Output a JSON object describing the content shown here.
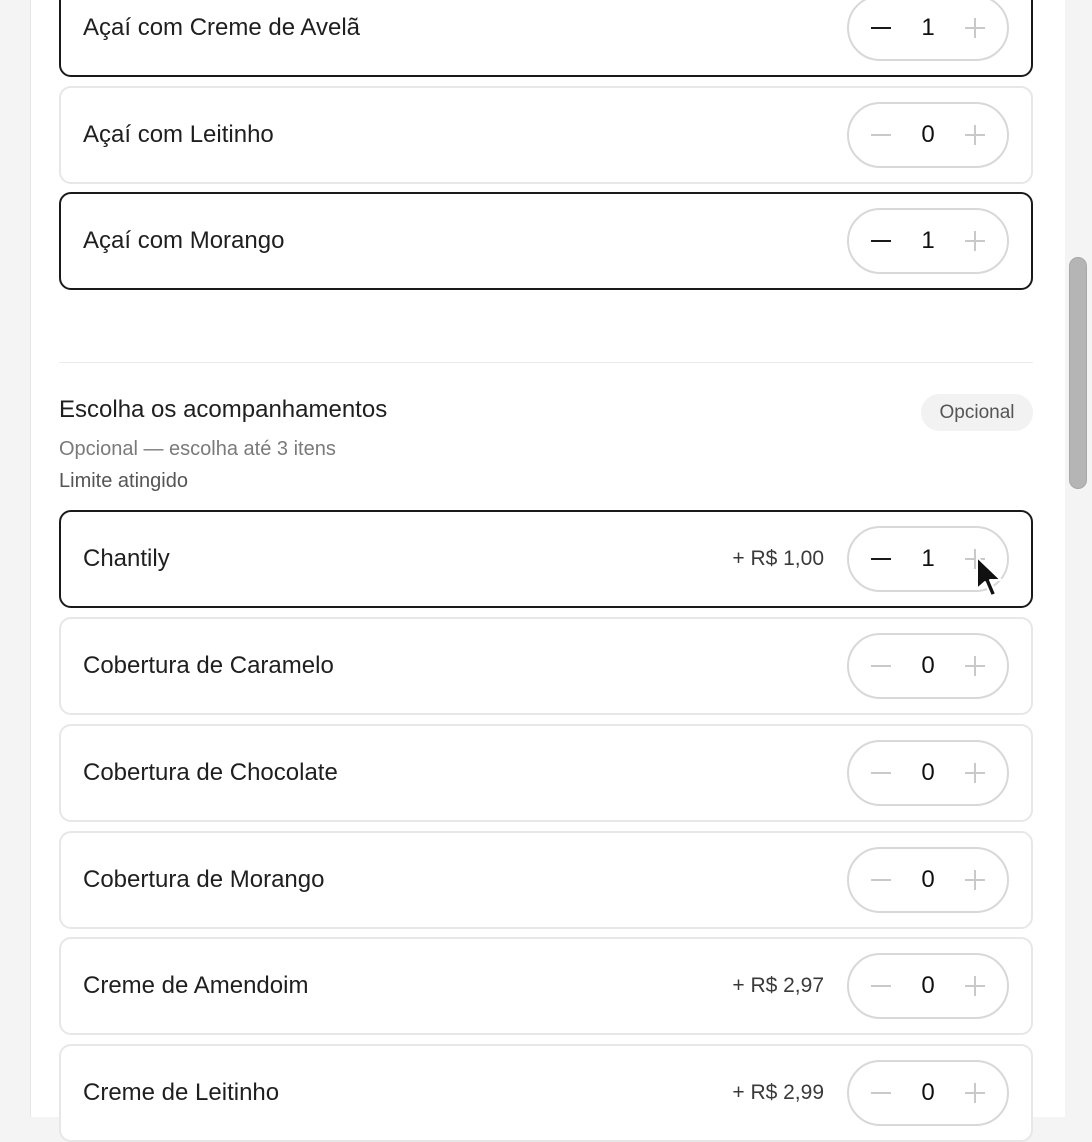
{
  "first_group": {
    "items": [
      {
        "label": "Açaí com Creme de Avelã",
        "qty": "1"
      },
      {
        "label": "Açaí com Leitinho",
        "qty": "0"
      },
      {
        "label": "Açaí com Morango",
        "qty": "1"
      }
    ]
  },
  "toppings": {
    "title": "Escolha os acompanhamentos",
    "badge": "Opcional",
    "subtitle": "Opcional — escolha até 3 itens",
    "limit_note": "Limite atingido",
    "items": [
      {
        "label": "Chantily",
        "price": "+ R$ 1,00",
        "qty": "1"
      },
      {
        "label": "Cobertura de Caramelo",
        "qty": "0"
      },
      {
        "label": "Cobertura de Chocolate",
        "qty": "0"
      },
      {
        "label": "Cobertura de Morango",
        "qty": "0"
      },
      {
        "label": "Creme de Amendoim",
        "price": "+ R$ 2,97",
        "qty": "0"
      },
      {
        "label": "Creme de Leitinho",
        "price": "+ R$ 2,99",
        "qty": "0"
      }
    ]
  },
  "icons": {
    "decrease": "minus-icon",
    "increase": "plus-icon",
    "pointer": "mouse-cursor-icon"
  },
  "colors": {
    "selected_border": "#1a1a1a",
    "default_border": "#e7e7e7",
    "disabled_icon": "#c9c9c9"
  }
}
